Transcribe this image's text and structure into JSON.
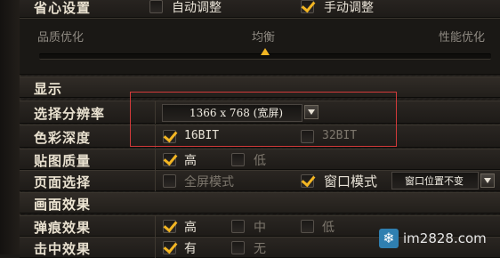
{
  "top_row": {
    "label": "省心设置",
    "auto_option": "自动调整",
    "manual_option": "手动调整"
  },
  "slider": {
    "left_label": "品质优化",
    "center_label": "均衡",
    "right_label": "性能优化",
    "value": 0.5
  },
  "display_section": {
    "title": "显示"
  },
  "resolution": {
    "label": "选择分辨率",
    "value": "1366 x 768 (宽屏)"
  },
  "color_depth": {
    "label": "色彩深度",
    "option_16": "16BIT",
    "option_32": "32BIT"
  },
  "texture": {
    "label": "贴图质量",
    "high": "高",
    "low": "低"
  },
  "page_mode": {
    "label": "页面选择",
    "fullscreen": "全屏模式",
    "windowed": "窗口模式",
    "window_position": "窗口位置不变"
  },
  "effects_section": {
    "title": "画面效果"
  },
  "bullet_effect": {
    "label": "弹痕效果",
    "high": "高",
    "mid": "中",
    "low": "低"
  },
  "hit_effect": {
    "label": "击中效果",
    "yes": "有",
    "no": "无"
  },
  "watermark": {
    "text": "im2828.com",
    "icon": "snowflake-icon"
  },
  "colors": {
    "accent": "#f3b623",
    "highlight_border": "#d23a3a"
  }
}
